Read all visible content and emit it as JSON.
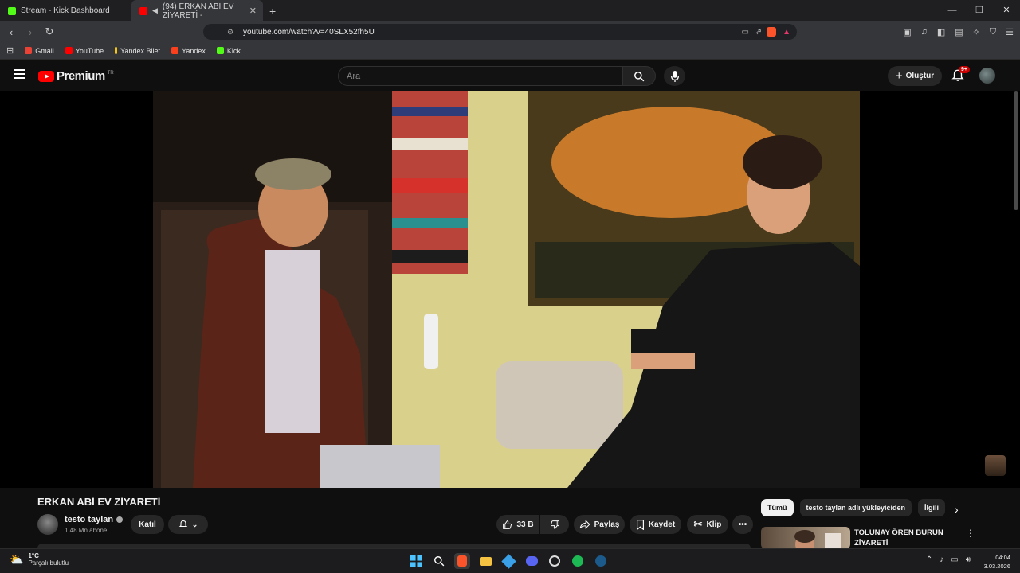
{
  "browser": {
    "tabs": [
      {
        "label": "Stream - Kick Dashboard",
        "active": false,
        "favicon_color": "#53fc18"
      },
      {
        "label": "(94) ERKAN ABİ EV ZİYARETİ -",
        "active": true,
        "favicon_color": "#ff0000"
      }
    ],
    "url": "youtube.com/watch?v=40SLX52fh5U",
    "bookmarks": [
      {
        "label": "Gmail",
        "color": "#ea4335"
      },
      {
        "label": "YouTube",
        "color": "#ff0000"
      },
      {
        "label": "Yandex.Bilet",
        "color": "#f5c518"
      },
      {
        "label": "Yandex",
        "color": "#fc3f1d"
      },
      {
        "label": "Kick",
        "color": "#53fc18"
      }
    ]
  },
  "youtube": {
    "logo_text": "Premium",
    "logo_region": "TR",
    "search_placeholder": "Ara",
    "create_label": "Oluştur",
    "notif_badge": "9+"
  },
  "video": {
    "title": "ERKAN ABİ EV ZİYARETİ",
    "channel": "testo taylan",
    "subscribers": "1,48 Mn abone",
    "join_label": "Katıl",
    "like_count": "33 B",
    "share_label": "Paylaş",
    "save_label": "Kaydet",
    "clip_label": "Klip"
  },
  "sidebar": {
    "chips": [
      {
        "label": "Tümü",
        "selected": true
      },
      {
        "label": "testo taylan adlı yükleyiciden",
        "selected": false
      },
      {
        "label": "İlgili",
        "selected": false
      }
    ],
    "rec_title": "TOLUNAY ÖREN BURUN ZİYARETİ"
  },
  "taskbar": {
    "temp": "1°C",
    "weather": "Parçalı bulutlu",
    "time": "04:04",
    "date": "3.03.2026"
  },
  "colors": {
    "accent": "#ff0000",
    "bg": "#0f0f0f",
    "chip": "#272727"
  }
}
